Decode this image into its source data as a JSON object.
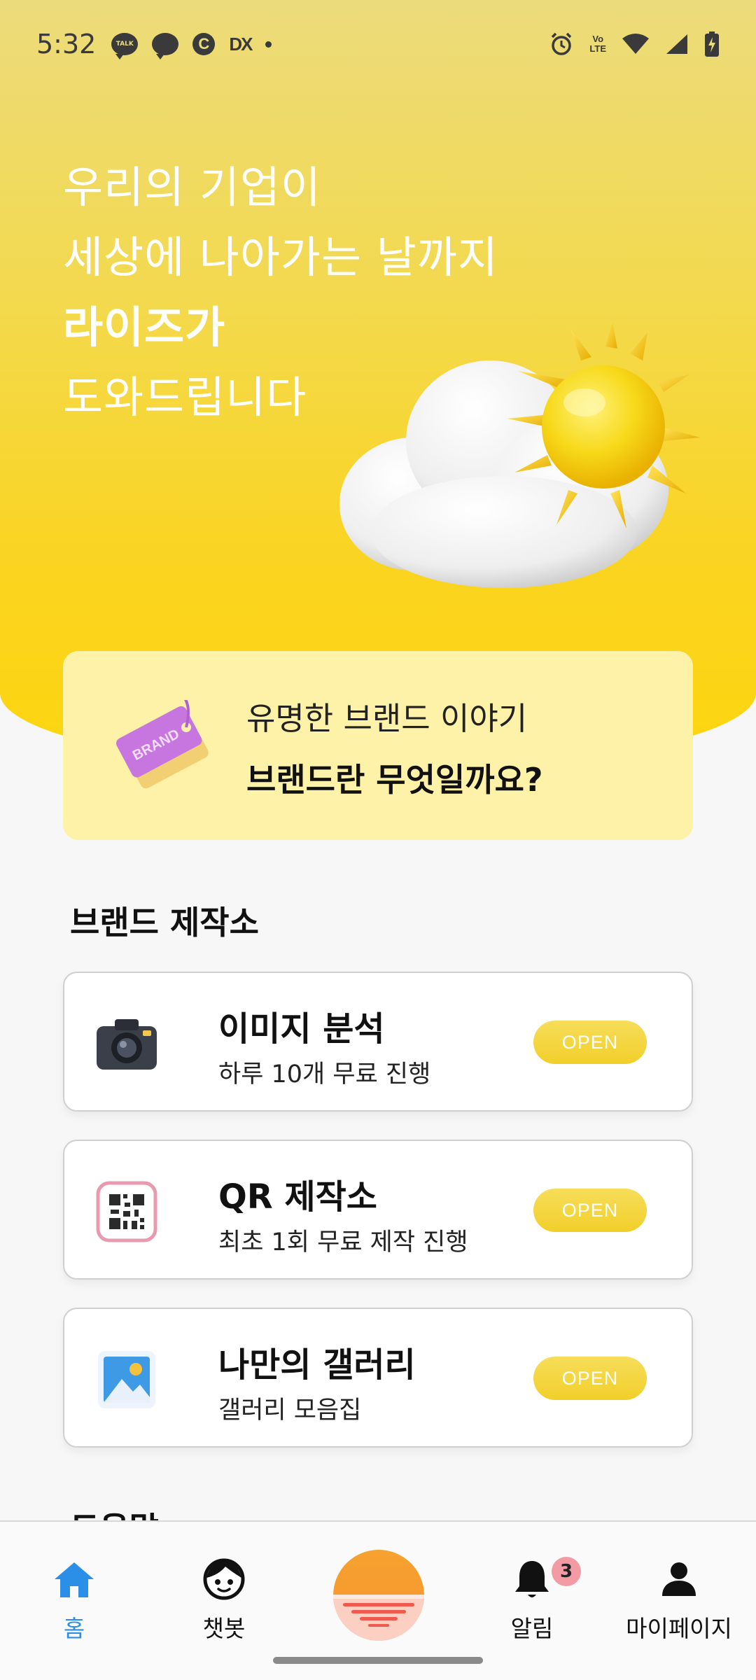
{
  "status_bar": {
    "time": "5:32",
    "left_icons": [
      "talk-icon",
      "chat-bubble-icon",
      "c-circle-icon",
      "dx-icon",
      "dot-icon"
    ],
    "right_icons": [
      "alarm-icon",
      "volte-icon",
      "wifi-icon",
      "signal-icon",
      "battery-charging-icon"
    ],
    "talk_text": "TALK",
    "c_text": "C",
    "dx_text": "DX",
    "volte_text": "Vo)\nLTE"
  },
  "hero": {
    "lines": [
      "우리의 기업이",
      "세상에 나아가는 날까지",
      "라이즈가",
      "도와드립니다"
    ],
    "illustration": "sun-cloud-illustration"
  },
  "brand_banner": {
    "subtitle": "유명한 브랜드 이야기",
    "title": "브랜드란 무엇일까요?",
    "icon": "brand-tag-icon",
    "tag_text": "BRAND"
  },
  "section": {
    "title": "브랜드 제작소",
    "next_title_peek": "도움말"
  },
  "cards": [
    {
      "title": "이미지 분석",
      "subtitle": "하루 10개 무료 진행",
      "button": "OPEN",
      "icon": "camera-icon"
    },
    {
      "title": "QR 제작소",
      "subtitle": "최초 1회 무료 제작 진행",
      "button": "OPEN",
      "icon": "qr-code-icon"
    },
    {
      "title": "나만의 갤러리",
      "subtitle": "갤러리 모음집",
      "button": "OPEN",
      "icon": "gallery-icon"
    }
  ],
  "bottom_nav": {
    "items": [
      {
        "label": "홈",
        "icon": "home-icon",
        "active": true
      },
      {
        "label": "챗봇",
        "icon": "chatbot-face-icon",
        "active": false
      },
      {
        "label": "",
        "icon": "sunrise-icon",
        "active": false
      },
      {
        "label": "알림",
        "icon": "bell-icon",
        "active": false,
        "badge": "3"
      },
      {
        "label": "마이페이지",
        "icon": "person-icon",
        "active": false
      }
    ]
  },
  "colors": {
    "accent_blue": "#2b8fe8",
    "hero_yellow": "#fdd50f",
    "banner_yellow": "#fdf2a8",
    "button_yellow": "#f1cf2a",
    "center_orange": "#f79a2e",
    "badge_pink": "#f29ba4"
  }
}
